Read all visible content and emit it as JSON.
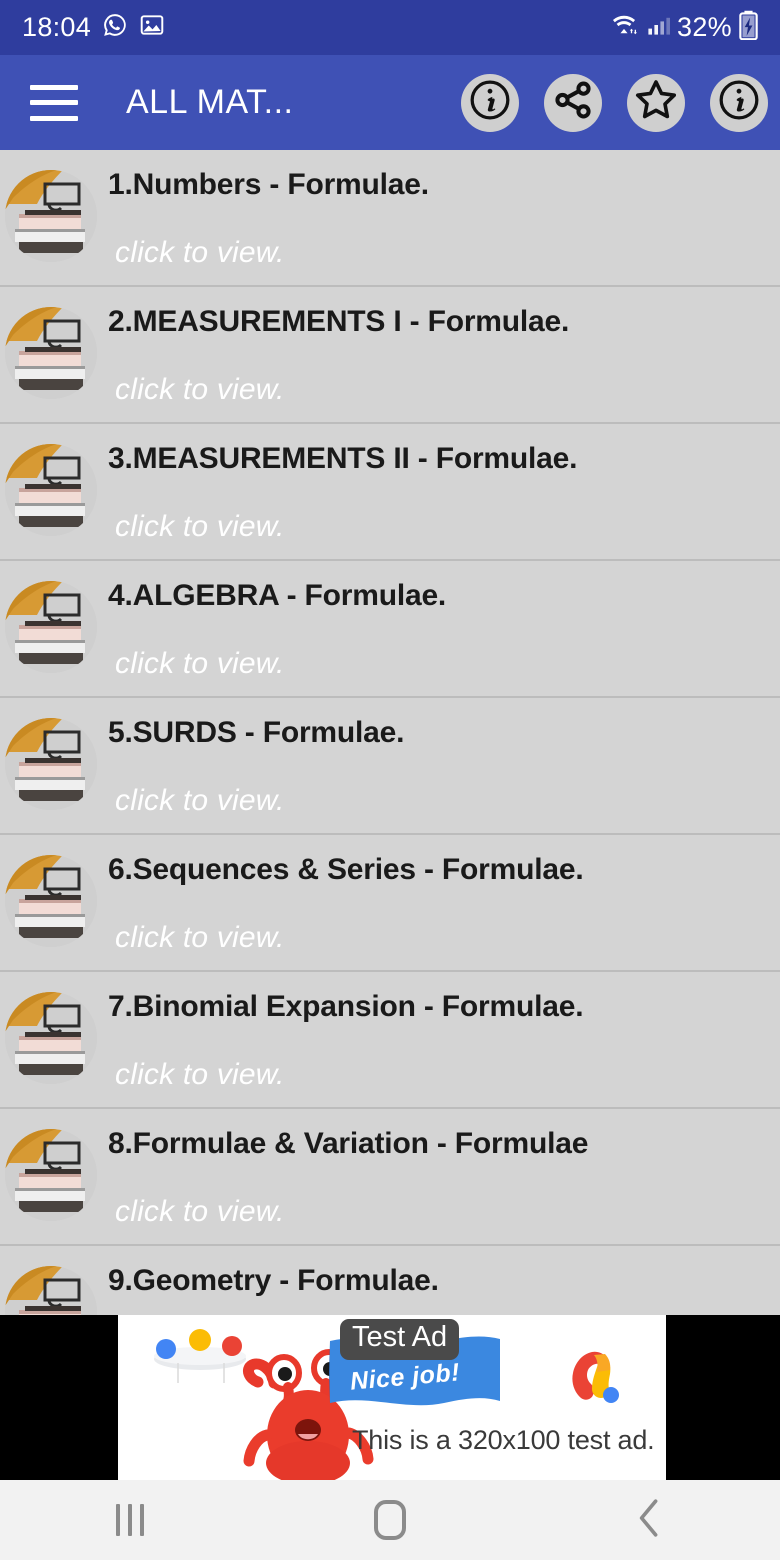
{
  "status_bar": {
    "time": "18:04",
    "battery_percent": "32%",
    "icons": [
      "whatsapp-icon",
      "image-icon",
      "wifi-icon",
      "cellular-signal-icon",
      "battery-charging-icon"
    ],
    "background_color": "#2f3d9e"
  },
  "app_bar": {
    "title": "ALL MAT...",
    "menu_icon": "hamburger-menu-icon",
    "background_color": "#3f51b5",
    "actions": [
      {
        "name": "info-button",
        "icon": "info-icon"
      },
      {
        "name": "share-button",
        "icon": "share-icon"
      },
      {
        "name": "favorite-button",
        "icon": "star-outline-icon"
      },
      {
        "name": "about-button",
        "icon": "info-icon"
      }
    ]
  },
  "list": {
    "subtitle_default": "click to view.",
    "background_color": "#d4d4d4",
    "items": [
      {
        "title": "1.Numbers - Formulae.",
        "subtitle": "click to view."
      },
      {
        "title": "2.MEASUREMENTS I - Formulae.",
        "subtitle": "click to view."
      },
      {
        "title": "3.MEASUREMENTS II - Formulae.",
        "subtitle": "click to view."
      },
      {
        "title": "4.ALGEBRA - Formulae.",
        "subtitle": "click to view."
      },
      {
        "title": "5.SURDS - Formulae.",
        "subtitle": "click to view."
      },
      {
        "title": "6.Sequences & Series - Formulae.",
        "subtitle": "click to view."
      },
      {
        "title": "7.Binomial Expansion - Formulae.",
        "subtitle": "click to view."
      },
      {
        "title": "8.Formulae & Variation - Formulae",
        "subtitle": "click to view."
      },
      {
        "title": "9.Geometry - Formulae.",
        "subtitle": ""
      }
    ]
  },
  "ad": {
    "label": "Test Ad",
    "ribbon_text": "Nice job!",
    "body_text": "This is a 320x100 test ad.",
    "logo": "admob-logo-icon",
    "letterbox_color": "#000000",
    "background_color": "#ffffff"
  },
  "nav_bar": {
    "recents": "recents-icon",
    "home": "home-icon",
    "back": "back-icon",
    "background_color": "#f2f2f2"
  }
}
